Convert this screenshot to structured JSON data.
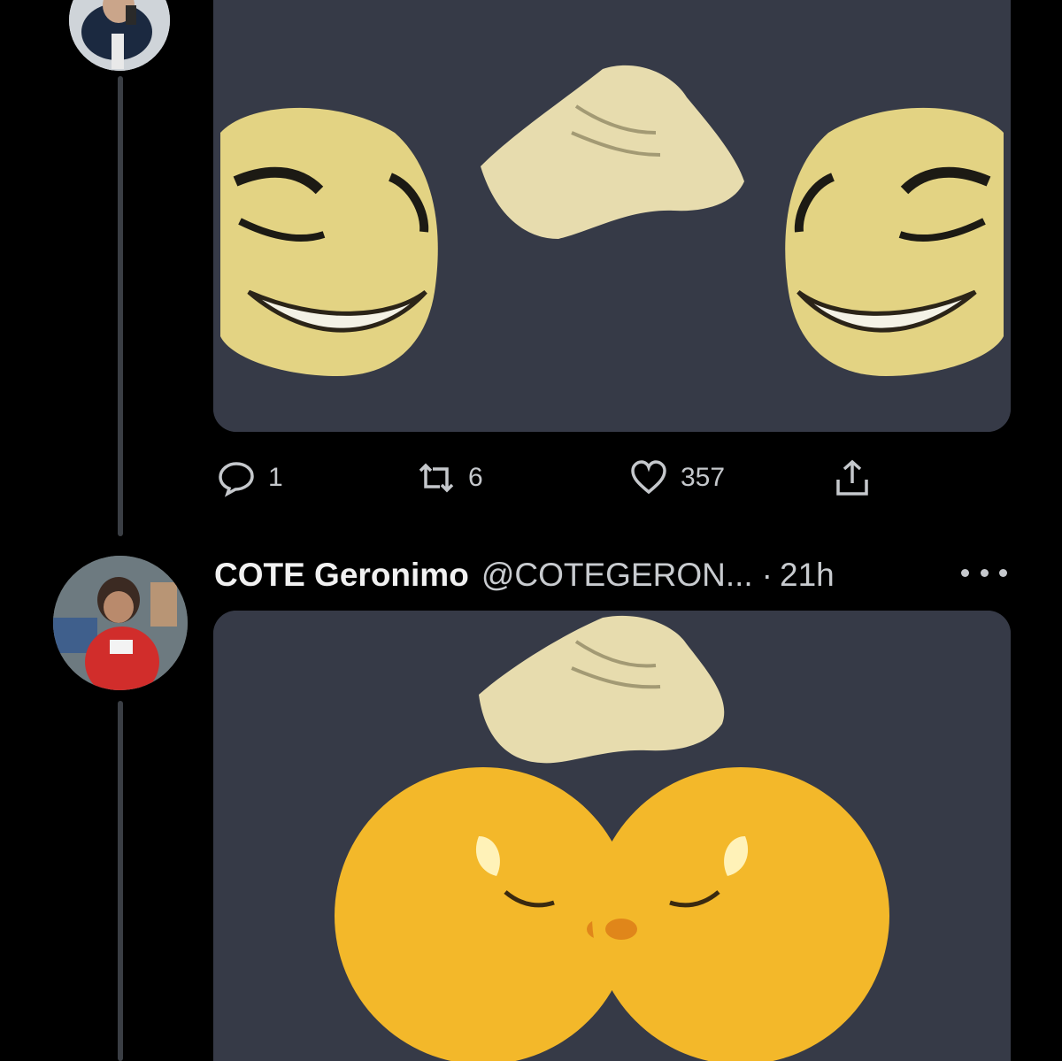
{
  "tweet1": {
    "stats": {
      "replies": "1",
      "retweets": "6",
      "likes": "357"
    },
    "icons": [
      "reply-icon",
      "retweet-icon",
      "like-icon",
      "share-icon"
    ]
  },
  "tweet2": {
    "author_name": "COTE Geronimo",
    "author_handle": "@COTEGERON...",
    "separator": "·",
    "timestamp": "21h",
    "more_icon": "more-options-icon"
  },
  "colors": {
    "background": "#000000",
    "media_bg": "#363a47",
    "emoji_yellow": "#e8d37a",
    "text_primary": "#f1f1f1",
    "text_secondary": "#c8cbcf"
  }
}
